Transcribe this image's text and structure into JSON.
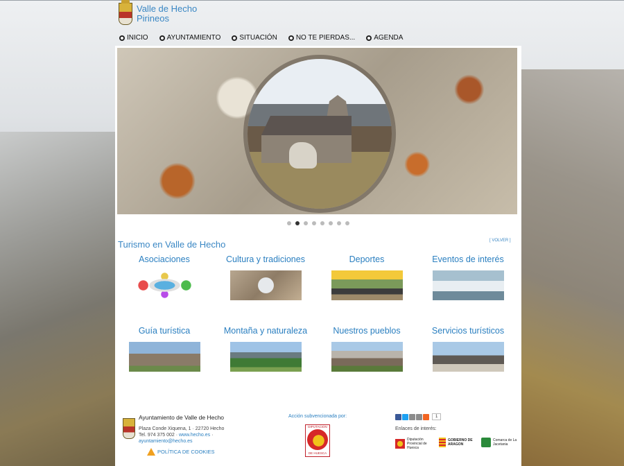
{
  "header": {
    "title": "Valle de Hecho",
    "subtitle": "Pirineos"
  },
  "nav": {
    "items": [
      {
        "label": "INICIO"
      },
      {
        "label": "AYUNTAMIENTO"
      },
      {
        "label": "SITUACIÓN"
      },
      {
        "label": "NO TE PIERDAS..."
      },
      {
        "label": "AGENDA"
      }
    ]
  },
  "slider": {
    "dot_count": 8,
    "active_dot": 1
  },
  "section": {
    "title": "Turismo en Valle de Hecho",
    "back": "[ VOLVER ]"
  },
  "categories": [
    {
      "label": "Asociaciones"
    },
    {
      "label": "Cultura y tradiciones"
    },
    {
      "label": "Deportes"
    },
    {
      "label": "Eventos de interés"
    },
    {
      "label": "Guía turística"
    },
    {
      "label": "Montaña y naturaleza"
    },
    {
      "label": "Nuestros pueblos"
    },
    {
      "label": "Servicios turísticos"
    }
  ],
  "footer": {
    "name": "Ayuntamiento de Valle de Hecho",
    "address": "Plaza Conde Xiquena, 1 · 22720 Hecho",
    "phone": "Tel. 974 375 002 ·",
    "web": "www.hecho.es",
    "sep": "·",
    "email": "ayuntamiento@hecho.es",
    "cookies": "POLÍTICA DE COOKIES",
    "subsidized": "Acción subvencionada por:",
    "dph_top": "DIPUTACION",
    "dph_bottom": "DE HUESCA",
    "share_count": "1",
    "links_label": "Enlaces de interés:",
    "link1": "Diputación Provincial de Huesca",
    "link2": "GOBIERNO DE ARAGON",
    "link3": "Comarca de La Jacetania"
  },
  "colors": {
    "accent": "#3a87c4",
    "link": "#2a7fc0"
  }
}
